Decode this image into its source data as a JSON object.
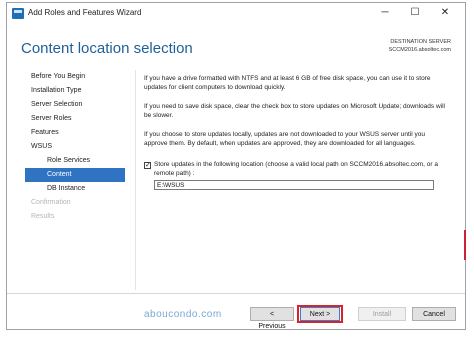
{
  "window": {
    "title": "Add Roles and Features Wizard",
    "controls": {
      "minimize": "─",
      "maximize": "☐",
      "close": "✕"
    }
  },
  "header": {
    "page_title": "Content location selection",
    "destination_label": "DESTINATION SERVER",
    "destination_server": "SCCM2016.absoltec.com"
  },
  "nav": {
    "items": [
      {
        "label": "Before You Begin",
        "state": "normal"
      },
      {
        "label": "Installation Type",
        "state": "normal"
      },
      {
        "label": "Server Selection",
        "state": "normal"
      },
      {
        "label": "Server Roles",
        "state": "normal"
      },
      {
        "label": "Features",
        "state": "normal"
      },
      {
        "label": "WSUS",
        "state": "normal"
      },
      {
        "label": "Role Services",
        "state": "sub"
      },
      {
        "label": "Content",
        "state": "active"
      },
      {
        "label": "DB Instance",
        "state": "sub"
      },
      {
        "label": "Confirmation",
        "state": "disabled"
      },
      {
        "label": "Results",
        "state": "disabled"
      }
    ]
  },
  "content": {
    "p1": "If you have a drive formatted with NTFS and at least 6 GB of free disk space, you can use it to store updates for client computers to download quickly.",
    "p2": "If you need to save disk space, clear the check box to store updates on Microsoft Update; downloads will be slower.",
    "p3": "If you choose to store updates locally, updates are not downloaded to your WSUS server until you approve them. By default, when updates are approved, they are downloaded for all languages.",
    "checkbox_checked": true,
    "checkbox_mark": "✓",
    "checkbox_label": "Store updates in the following location (choose a valid local path on SCCM2016.absoltec.com, or a remote path) :",
    "path_value": "E:\\WSUS"
  },
  "footer": {
    "previous": "< Previous",
    "next": "Next >",
    "install": "Install",
    "cancel": "Cancel"
  },
  "watermark": "aboucondo.com",
  "colors": {
    "title_blue": "#1f5f99",
    "nav_active": "#2f73c2",
    "highlight_red": "#d8232a"
  }
}
